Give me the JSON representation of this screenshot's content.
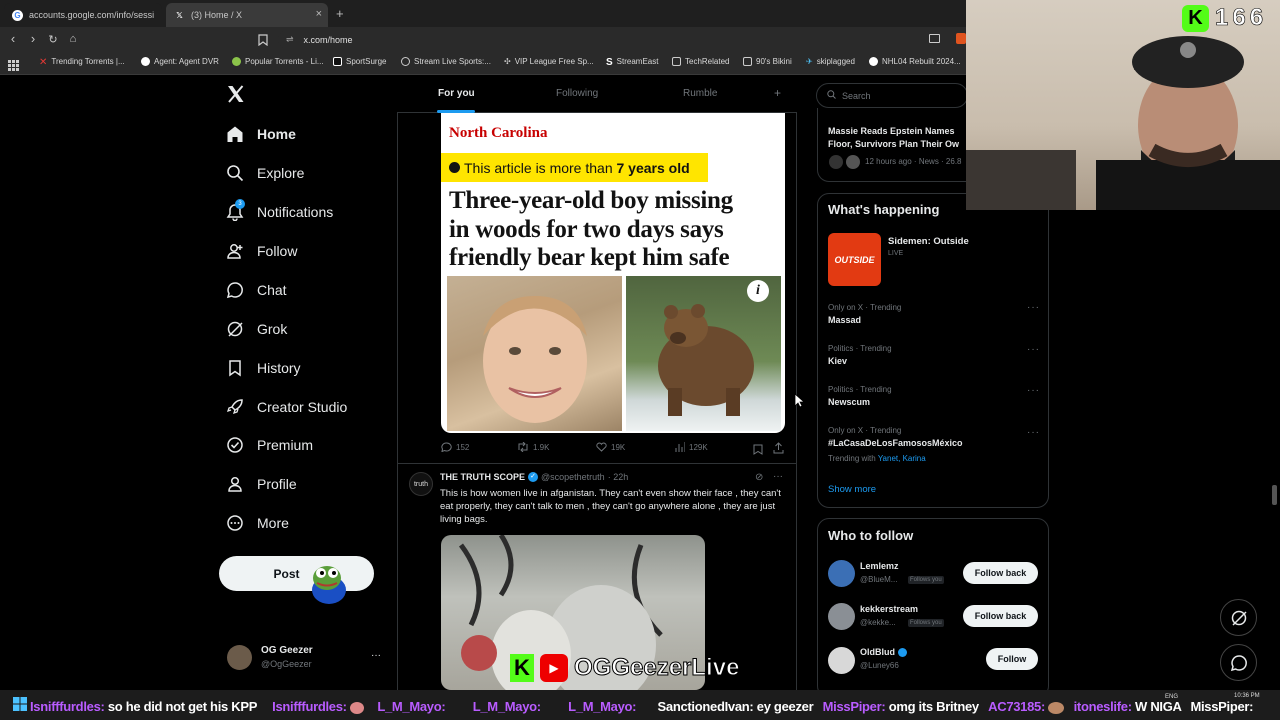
{
  "browser": {
    "tabs": [
      {
        "label": "accounts.google.com/info/sessionex"
      },
      {
        "label": "(3) Home / X"
      }
    ],
    "url": "x.com/home",
    "bookmarks": [
      {
        "label": "Trending Torrents |..."
      },
      {
        "label": "Agent: Agent DVR"
      },
      {
        "label": "Popular Torrents - Li..."
      },
      {
        "label": "SportSurge"
      },
      {
        "label": "Stream Live Sports:..."
      },
      {
        "label": "VIP League Free Sp..."
      },
      {
        "label": "StreamEast"
      },
      {
        "label": "TechRelated"
      },
      {
        "label": "90's Bikini"
      },
      {
        "label": "skiplagged"
      },
      {
        "label": "NHL04 Rebuilt 2024..."
      }
    ]
  },
  "nav": {
    "items": [
      {
        "label": "Home"
      },
      {
        "label": "Explore"
      },
      {
        "label": "Notifications",
        "badge": "3"
      },
      {
        "label": "Follow"
      },
      {
        "label": "Chat"
      },
      {
        "label": "Grok"
      },
      {
        "label": "History"
      },
      {
        "label": "Creator Studio"
      },
      {
        "label": "Premium"
      },
      {
        "label": "Profile"
      },
      {
        "label": "More"
      }
    ],
    "post_label": "Post",
    "account": {
      "name": "OG Geezer",
      "handle": "@OgGeezer"
    }
  },
  "feed": {
    "tabs": [
      {
        "label": "For you"
      },
      {
        "label": "Following"
      },
      {
        "label": "Rumble"
      }
    ],
    "add_tab": "+",
    "article": {
      "region": "North Carolina",
      "age_notice_prefix": "This article is more than ",
      "age_notice_value": "7 years old",
      "headline_lines": [
        "Three-year-old boy missing",
        "in woods for two days says",
        "friendly bear kept him safe"
      ]
    },
    "actions": {
      "replies": "152",
      "reposts": "1.9K",
      "likes": "19K",
      "views": "129K"
    },
    "post2": {
      "author": "THE TRUTH SCOPE",
      "handle": "@scopethetruth",
      "time": "· 22h",
      "avatar_text": "truth",
      "text": "This is how women live in afganistan. They can't even show their face , they can't eat properly, they can't talk to men , they can't go anywhere alone , they are just living bags."
    }
  },
  "right": {
    "search_placeholder": "Search",
    "news": {
      "title": "Massie Reads Epstein Names Floor, Survivors Plan Their Ow",
      "meta": "12 hours ago · News · 26.8"
    },
    "whats_happening": "What's happening",
    "live": {
      "title": "Sidemen: Outside",
      "status": "LIVE",
      "thumb": "OUTSIDE"
    },
    "trends": [
      {
        "meta": "Only on X · Trending",
        "name": "Massad"
      },
      {
        "meta": "Politics · Trending",
        "name": "Kiev"
      },
      {
        "meta": "Politics · Trending",
        "name": "Newscum"
      },
      {
        "meta": "Only on X · Trending",
        "name": "#LaCasaDeLosFamososMéxico",
        "trending_with": "Trending with ",
        "names": "Yanet, Karina"
      }
    ],
    "show_more": "Show more",
    "who_to_follow": "Who to follow",
    "suggestions": [
      {
        "name": "Lemlemz",
        "handle": "@BlueM...",
        "follows_you": "Follows you",
        "button": "Follow back"
      },
      {
        "name": "kekkerstream",
        "handle": "@kekke...",
        "follows_you": "Follows you",
        "button": "Follow back"
      },
      {
        "name": "OldBlud",
        "handle": "@Luney66",
        "button": "Follow"
      }
    ]
  },
  "overlay": {
    "viewer_count": "166",
    "watermark": "OGGeezerLive",
    "chat": [
      {
        "user": "Isnifffurdles:",
        "msg": "so he did not get his KPP"
      },
      {
        "user": "Isnifffurdles:",
        "msg": ""
      },
      {
        "user": "L_M_Mayo:",
        "msg": ""
      },
      {
        "user": "L_M_Mayo:",
        "msg": ""
      },
      {
        "user": "L_M_Mayo:",
        "msg": ""
      },
      {
        "user": "SanctionedIvan:",
        "msg": "ey geezer"
      },
      {
        "user": "MissPiper:",
        "msg": "omg its Britney"
      },
      {
        "user": "AC73185:",
        "msg": ""
      },
      {
        "user": "itoneslife:",
        "msg": "W NIGA"
      },
      {
        "user": "MissPiper:",
        "msg": ""
      }
    ]
  },
  "taskbar": {
    "time": "10:36 PM",
    "lang": "ENG"
  }
}
